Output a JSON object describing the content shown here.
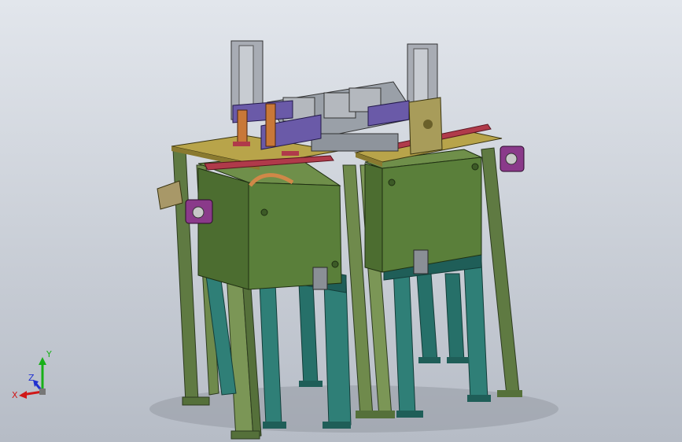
{
  "viewport": {
    "background_top": "#e2e6ec",
    "background_bottom": "#b6bcc6"
  },
  "colors": {
    "frame_green": "#6f8a4c",
    "frame_green_dark": "#55703a",
    "box_green": "#5a7f3a",
    "leg_teal": "#2f7f77",
    "leg_teal_dark": "#1f5e58",
    "top_yellow": "#b8a44a",
    "rail_red": "#b03a4a",
    "bracket_purple": "#6a5aa8",
    "mechanism_gray": "#9aa0a8",
    "motor_purple": "#8a3a8a"
  },
  "triad": {
    "x_label": "X",
    "y_label": "Y",
    "z_label": "Z",
    "x_color": "#d01818",
    "y_color": "#18b018",
    "z_color": "#2030d0"
  }
}
